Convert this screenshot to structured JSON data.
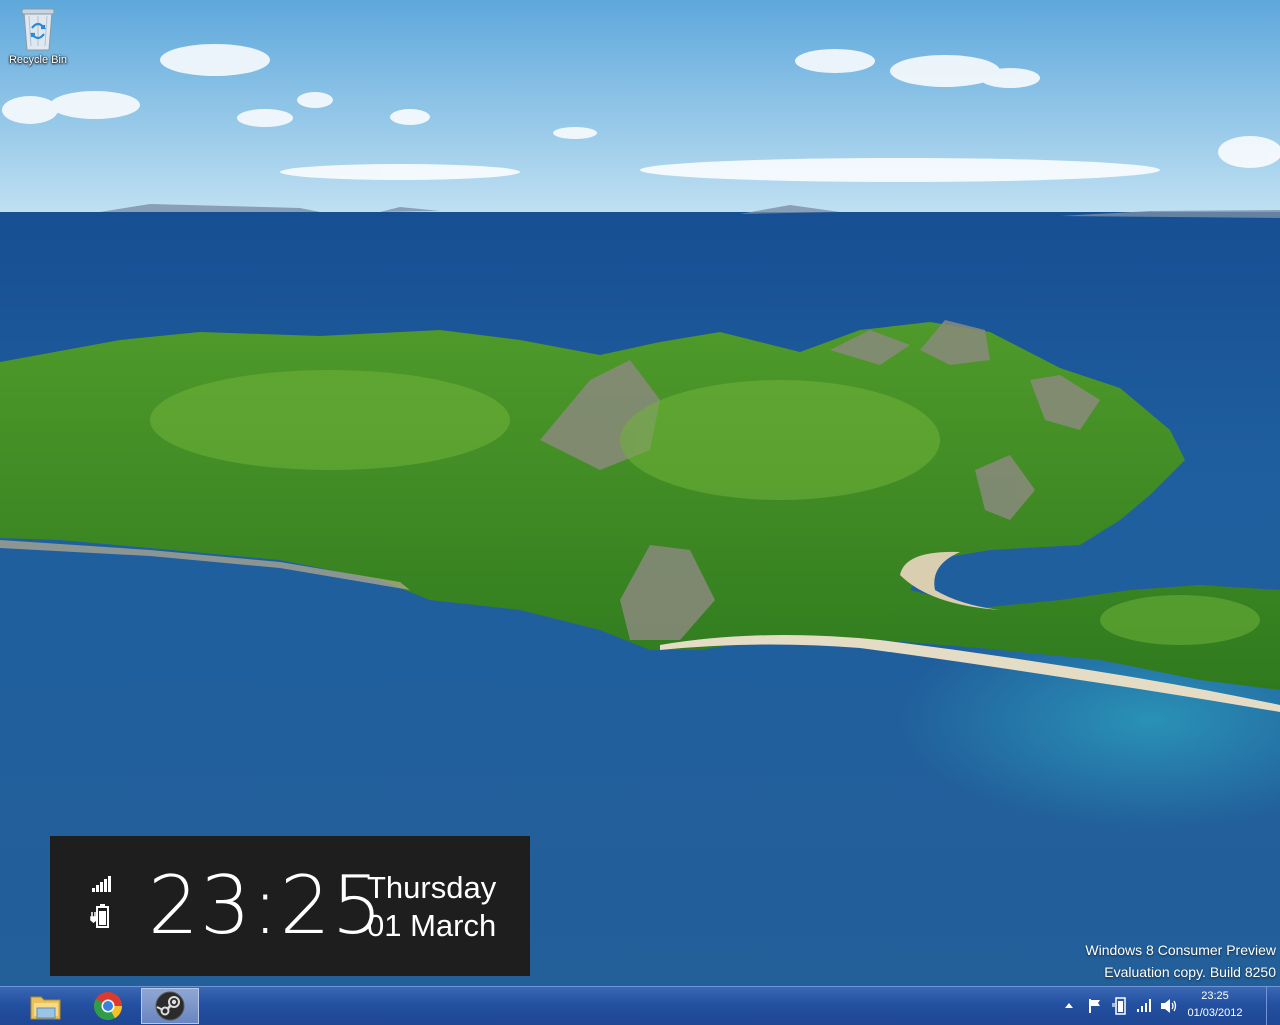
{
  "desktop": {
    "recycle_bin_label": "Recycle Bin"
  },
  "lock_clock": {
    "time": "23:25",
    "day": "Thursday",
    "date": "01 March",
    "icons": [
      "signal-icon",
      "battery-icon"
    ]
  },
  "watermark": {
    "line1": "Windows 8 Consumer Preview",
    "line2": "Evaluation copy. Build 8250"
  },
  "taskbar": {
    "pinned": [
      "file-explorer-icon",
      "chrome-icon",
      "steam-icon"
    ],
    "active": "steam",
    "tray": {
      "icons": [
        "show-hidden-icons",
        "action-center-flag-icon",
        "power-icon",
        "network-icon",
        "volume-icon"
      ],
      "time": "23:25",
      "date": "01/03/2012"
    }
  },
  "colors": {
    "taskbar": "#2350a0",
    "clock_panel": "#1e1e1e"
  }
}
